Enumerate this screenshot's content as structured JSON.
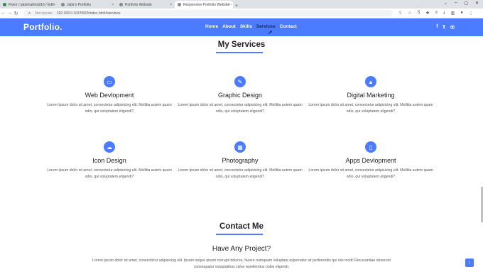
{
  "browser": {
    "tabs": [
      {
        "title": "Fiverr / jabirmalimutt16 / Edit",
        "active": false
      },
      {
        "title": "Jabir's Portfolio",
        "active": false
      },
      {
        "title": "Portfolio Website",
        "active": false
      },
      {
        "title": "Responsive Portfolio Website -",
        "active": true
      }
    ],
    "security": "Not secure",
    "url": "192.168.0.103:5502/index.html#services"
  },
  "site": {
    "logo": "Portfolio.",
    "menu": [
      "Home",
      "About",
      "Skills",
      "Services",
      "Contact"
    ],
    "active_menu": "Services",
    "social": [
      "f",
      "t",
      "ig"
    ],
    "accent": "#4b7bff"
  },
  "services": {
    "heading": "My Services",
    "items": [
      {
        "title": "Web Devlopment",
        "icon": "monitor-icon",
        "glyph": "▭",
        "text": "Lorem ipsum dolor sit amet, consectetur adipisicing elit. Mollitia autem quam odio, qui voluptatem eligendi?"
      },
      {
        "title": "Graphic Design",
        "icon": "pen-icon",
        "glyph": "✎",
        "text": "Lorem ipsum dolor sit amet, consectetur adipisicing elit. Mollitia autem quam odio, qui voluptatem eligendi?"
      },
      {
        "title": "Digital Marketing",
        "icon": "chart-icon",
        "glyph": "▲",
        "text": "Lorem ipsum dolor sit amet, consectetur adipisicing elit. Mollitia autem quam odio, qui voluptatem eligendi?"
      },
      {
        "title": "Icon Design",
        "icon": "cloud-icon",
        "glyph": "☁",
        "text": "Lorem ipsum dolor sit amet, consectetur adipisicing elit. Mollitia autem quam odio, qui voluptatem eligendi?"
      },
      {
        "title": "Photography",
        "icon": "calendar-icon",
        "glyph": "▦",
        "text": "Lorem ipsum dolor sit amet, consectetur adipisicing elit. Mollitia autem quam odio, qui voluptatem eligendi?"
      },
      {
        "title": "Apps Devlopment",
        "icon": "mobile-icon",
        "glyph": "▯",
        "text": "Lorem ipsum dolor sit amet, consectetur adipisicing elit. Mollitia autem quam odio, qui voluptatem eligendi?"
      }
    ]
  },
  "contact": {
    "heading": "Contact Me",
    "subheading": "Have Any Project?",
    "text": "Lorem ipsum dolor sit amet, consectetur adipisicing elit. Ipsam neque ipsum corrupti dolores, facere numquam voluptate aspernatur sit perferendis qui nisi modi! Recusandae deserunt consequatur voluptatibus cidos repellendus nobis eligendi."
  },
  "scroll_top": "↑"
}
